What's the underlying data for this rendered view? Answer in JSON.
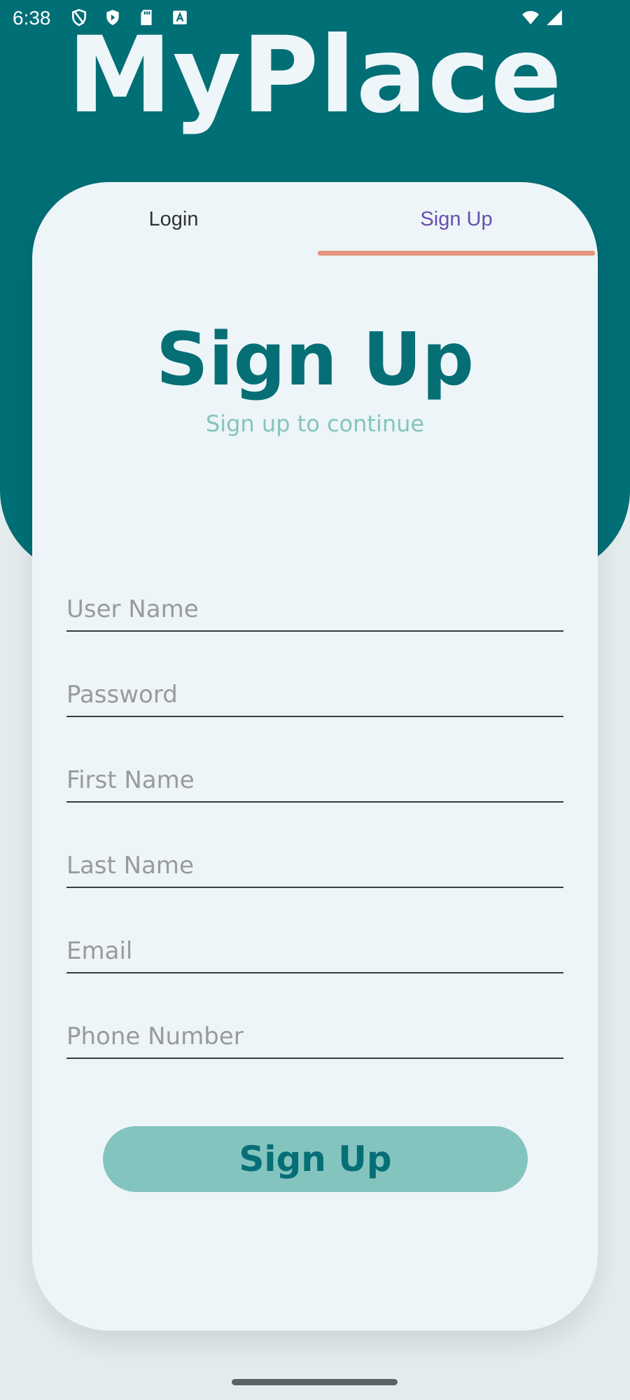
{
  "status_bar": {
    "time": "6:38",
    "left_icons": [
      "shield-icon",
      "play-protect-icon",
      "sd-card-icon",
      "a-badge-icon"
    ],
    "right_icons": [
      "wifi-icon",
      "signal-icon"
    ]
  },
  "app": {
    "title": "MyPlace"
  },
  "tabs": [
    {
      "label": "Login",
      "selected": false
    },
    {
      "label": "Sign Up",
      "selected": true
    }
  ],
  "form": {
    "heading": "Sign Up",
    "subheading": "Sign up to continue",
    "fields": [
      {
        "placeholder": "User Name",
        "value": ""
      },
      {
        "placeholder": "Password",
        "value": ""
      },
      {
        "placeholder": "First Name",
        "value": ""
      },
      {
        "placeholder": "Last Name",
        "value": ""
      },
      {
        "placeholder": "Email",
        "value": ""
      },
      {
        "placeholder": "Phone Number",
        "value": ""
      }
    ],
    "submit_label": "Sign Up"
  },
  "colors": {
    "primary": "#016f76",
    "accent": "#84c4bf",
    "tab_indicator": "#e4957c",
    "tab_selected_text": "#6a4fb0",
    "card_bg": "#edf5f8"
  }
}
